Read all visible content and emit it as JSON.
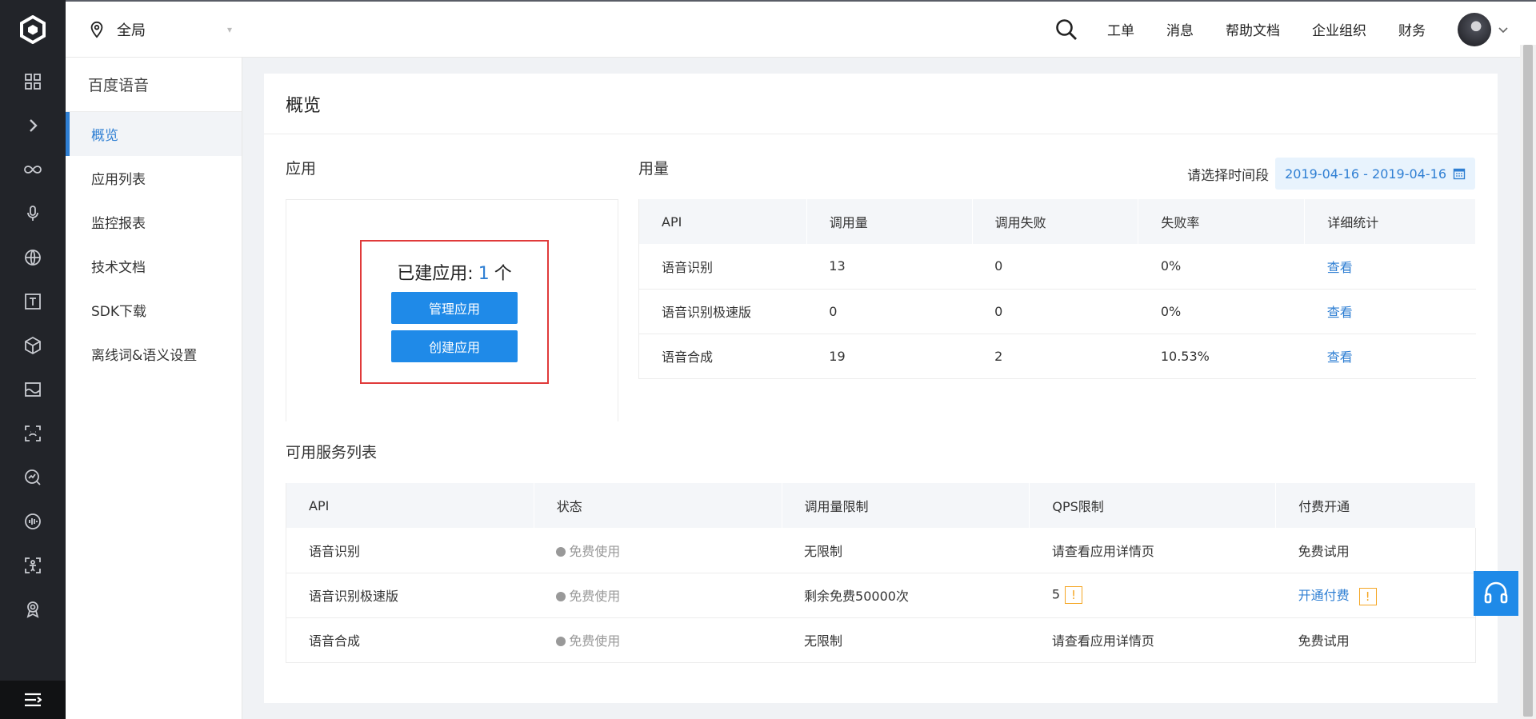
{
  "topbar": {
    "region": "全局",
    "nav": [
      "工单",
      "消息",
      "帮助文档",
      "企业组织",
      "财务"
    ]
  },
  "rail": {
    "icons": [
      "dashboard-icon",
      "expand-icon",
      "infinity-icon",
      "microphone-icon",
      "globe-icon",
      "text-icon",
      "cube-icon",
      "image-icon",
      "face-scan-icon",
      "chart-search-icon",
      "audio-icon",
      "body-scan-icon",
      "badge-icon"
    ]
  },
  "subnav": {
    "title": "百度语音",
    "items": [
      "概览",
      "应用列表",
      "监控报表",
      "技术文档",
      "SDK下载",
      "离线词&语义设置"
    ]
  },
  "main": {
    "title": "概览",
    "apps": {
      "section_title": "应用",
      "count_prefix": "已建应用:",
      "count": "1",
      "count_suffix": "个",
      "manage_label": "管理应用",
      "create_label": "创建应用"
    },
    "usage": {
      "section_title": "用量",
      "date_label": "请选择时间段",
      "date_range": "2019-04-16 - 2019-04-16",
      "headers": [
        "API",
        "调用量",
        "调用失败",
        "失败率",
        "详细统计"
      ],
      "rows": [
        {
          "api": "语音识别",
          "calls": "13",
          "fails": "0",
          "rate": "0%",
          "detail": "查看"
        },
        {
          "api": "语音识别极速版",
          "calls": "0",
          "fails": "0",
          "rate": "0%",
          "detail": "查看"
        },
        {
          "api": "语音合成",
          "calls": "19",
          "fails": "2",
          "rate": "10.53%",
          "detail": "查看"
        }
      ]
    },
    "services": {
      "section_title": "可用服务列表",
      "headers": [
        "API",
        "状态",
        "调用量限制",
        "QPS限制",
        "付费开通"
      ],
      "rows": [
        {
          "api": "语音识别",
          "status": "免费使用",
          "limit": "无限制",
          "qps": "请查看应用详情页",
          "pay": "免费试用"
        },
        {
          "api": "语音识别极速版",
          "status": "免费使用",
          "limit": "剩余免费50000次",
          "qps": "5",
          "pay": "开通付费"
        },
        {
          "api": "语音合成",
          "status": "免费使用",
          "limit": "无限制",
          "qps": "请查看应用详情页",
          "pay": "免费试用"
        }
      ],
      "warn_mark": "!"
    }
  },
  "colors": {
    "accent": "#1f8ae8",
    "link": "#2f7fd3",
    "rail_bg": "#222429",
    "highlight_box": "#e03a3a",
    "warning": "#f5a623"
  }
}
